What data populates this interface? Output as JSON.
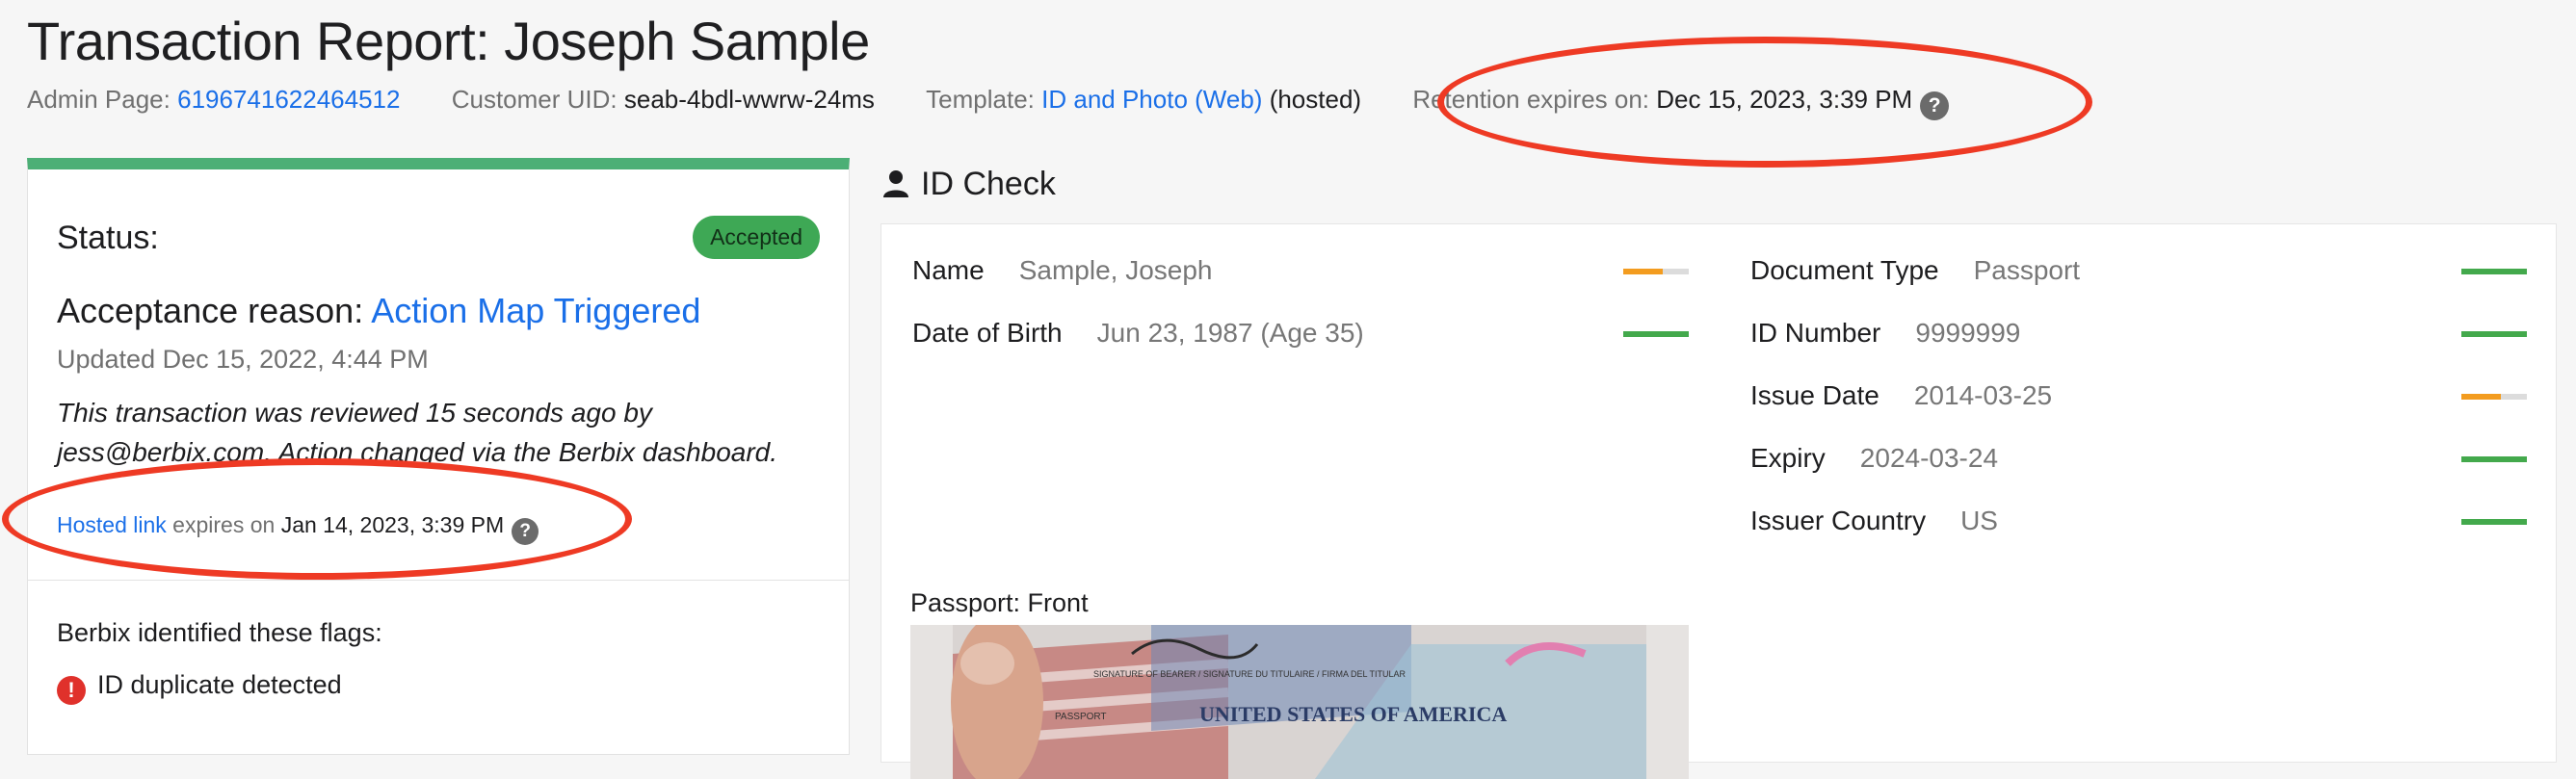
{
  "report": {
    "title": "Transaction Report: Joseph Sample",
    "admin_label": "Admin Page:",
    "admin_id": "6196741622464512",
    "customer_uid_label": "Customer UID:",
    "customer_uid": "seab-4bdl-wwrw-24ms",
    "template_label": "Template:",
    "template_name": "ID and Photo (Web)",
    "template_suffix": "(hosted)",
    "retention_label": "Retention expires on:",
    "retention_date": "Dec 15, 2023, 3:39 PM",
    "help_glyph": "?"
  },
  "status": {
    "label": "Status:",
    "badge": "Accepted",
    "reason_label": "Acceptance reason:",
    "reason_link": "Action Map Triggered",
    "updated": "Updated Dec 15, 2022, 4:44 PM",
    "review_note": "This transaction was reviewed 15 seconds ago by jess@berbix.com. Action changed via the Berbix dashboard.",
    "hosted_link": "Hosted link",
    "hosted_expires_label": "expires on",
    "hosted_expires_date": "Jan 14, 2023, 3:39 PM",
    "flags_title": "Berbix identified these flags:",
    "flags": [
      {
        "icon": "!",
        "text": "ID duplicate detected"
      }
    ]
  },
  "id_check": {
    "title": "ID Check",
    "left_fields": [
      {
        "label": "Name",
        "value": "Sample, Joseph",
        "score": 0.6,
        "score_color": "#f39c1f"
      },
      {
        "label": "Date of Birth",
        "value": "Jun 23, 1987 (Age 35)",
        "score": 1.0,
        "score_color": "#43a94c"
      }
    ],
    "right_fields": [
      {
        "label": "Document Type",
        "value": "Passport",
        "score": 1.0,
        "score_color": "#43a94c"
      },
      {
        "label": "ID Number",
        "value": "9999999",
        "score": 1.0,
        "score_color": "#43a94c"
      },
      {
        "label": "Issue Date",
        "value": "2014-03-25",
        "score": 0.6,
        "score_color": "#f39c1f"
      },
      {
        "label": "Expiry",
        "value": "2024-03-24",
        "score": 1.0,
        "score_color": "#43a94c"
      },
      {
        "label": "Issuer Country",
        "value": "US",
        "score": 1.0,
        "score_color": "#43a94c"
      }
    ],
    "passport_label": "Passport: Front",
    "passport_text": "UNITED STATES OF AMERICA",
    "passport_small": "PASSPORT",
    "signature_caption": "SIGNATURE OF BEARER / SIGNATURE DU TITULAIRE / FIRMA DEL TITULAR"
  },
  "colors": {
    "accent_link": "#1a6fe8",
    "status_bar": "#4caf76",
    "badge_bg": "#3ea855",
    "annotation": "#ee3a24",
    "flag_icon": "#e0312b"
  }
}
